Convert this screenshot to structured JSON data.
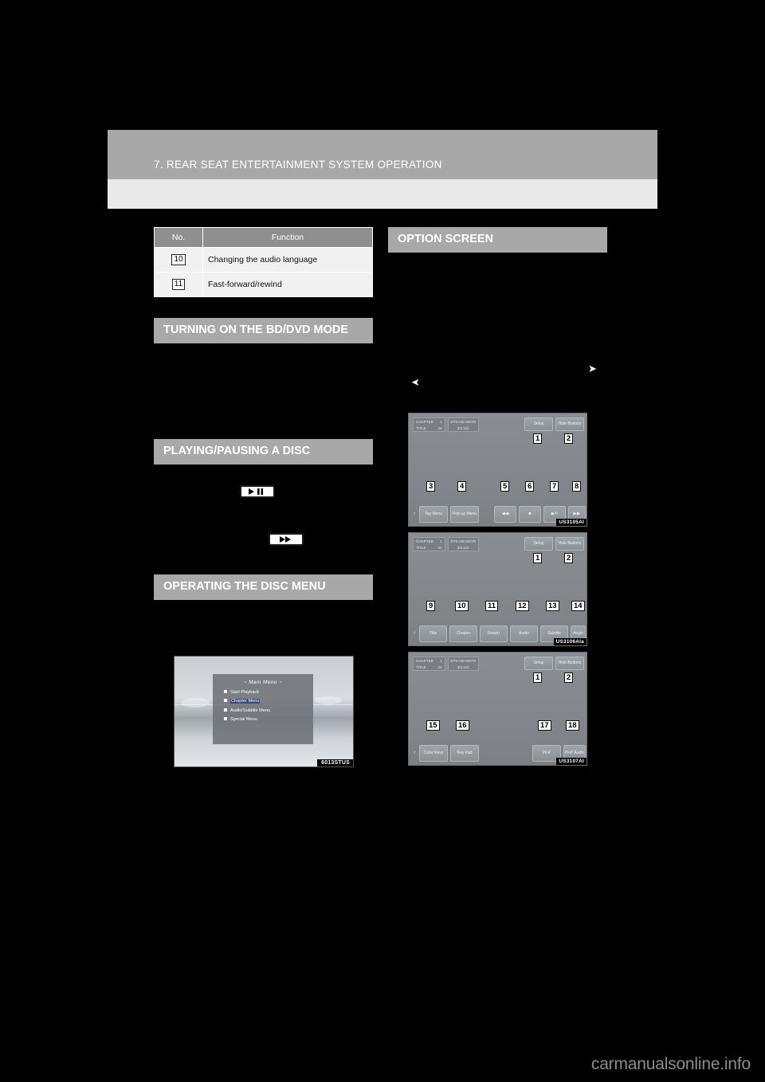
{
  "header": {
    "chapter_title": "7. REAR SEAT ENTERTAINMENT SYSTEM OPERATION"
  },
  "left_column": {
    "table": {
      "columns": [
        "No.",
        "Function"
      ],
      "rows": [
        {
          "no": "10",
          "function": "Changing the audio language"
        },
        {
          "no": "11",
          "function": "Fast-forward/rewind"
        }
      ]
    },
    "sections": [
      {
        "title": "TURNING ON THE BD/DVD MODE"
      },
      {
        "title": "PLAYING/PAUSING A DISC"
      },
      {
        "title": "OPERATING THE DISC MENU"
      }
    ],
    "inline_buttons": {
      "play_pause": "play-pause",
      "fast_forward": "fast-forward"
    },
    "figure": {
      "code": "6013STUS",
      "menu_title": "~  Main Menu  ~",
      "items": [
        {
          "label": "Start Playback",
          "selected": false
        },
        {
          "label": "Chapter Menu",
          "selected": true
        },
        {
          "label": "Audio/Subtitle Menu",
          "selected": false
        },
        {
          "label": "Special Menu",
          "selected": false
        }
      ]
    }
  },
  "right_column": {
    "section_title": "OPTION SCREEN",
    "ref_arrow_left": "➤",
    "ref_arrow_right": "➤",
    "screens": [
      {
        "code": "US3105AI",
        "info": {
          "chapter_label": "CHAPTER",
          "chapter_value": "1",
          "title_label": "TITLE",
          "title_value": "24",
          "audio_format": "DTS-HD MSTR",
          "audio_channels": "3/2.1ch"
        },
        "top_buttons": [
          {
            "label": "Setup",
            "callout": "1"
          },
          {
            "label": "Hide Buttons",
            "callout": "2"
          }
        ],
        "bottom_buttons": [
          {
            "label": "Top Menu",
            "callout": "3"
          },
          {
            "label": "Pop-up Menu",
            "callout": "4"
          },
          {
            "label": "◀◀",
            "callout": "5"
          },
          {
            "label": "■",
            "callout": "6"
          },
          {
            "label": "▶II",
            "callout": "7"
          },
          {
            "label": "▶▶",
            "callout": "8"
          }
        ],
        "pager_prev": "‹",
        "pager_next": "›"
      },
      {
        "code": "US3106AIa",
        "info": {
          "chapter_label": "CHAPTER",
          "chapter_value": "1",
          "title_label": "TITLE",
          "title_value": "24",
          "audio_format": "DTS-HD MSTR",
          "audio_channels": "3/2.1ch"
        },
        "top_buttons": [
          {
            "label": "Setup",
            "callout": "1"
          },
          {
            "label": "Hide Buttons",
            "callout": "2"
          }
        ],
        "bottom_buttons": [
          {
            "label": "Title",
            "callout": "9"
          },
          {
            "label": "Chapter",
            "callout": "10"
          },
          {
            "label": "Return",
            "callout": "11"
          },
          {
            "label": "Audio",
            "callout": "12"
          },
          {
            "label": "Subtitle",
            "callout": "13"
          },
          {
            "label": "Angle",
            "callout": "14"
          }
        ],
        "pager_prev": "‹",
        "pager_next": "›"
      },
      {
        "code": "US3107AI",
        "info": {
          "chapter_label": "CHAPTER",
          "chapter_value": "1",
          "title_label": "TITLE",
          "title_value": "24",
          "audio_format": "DTS-HD MSTR",
          "audio_channels": "3/2.1ch"
        },
        "top_buttons": [
          {
            "label": "Setup",
            "callout": "1"
          },
          {
            "label": "Hide Buttons",
            "callout": "2"
          }
        ],
        "bottom_buttons": [
          {
            "label": "Color Keys",
            "callout": "15"
          },
          {
            "label": "Key Pad",
            "callout": "16"
          },
          {
            "label": "PinP",
            "callout": "17"
          },
          {
            "label": "PinP Audio",
            "callout": "18"
          }
        ],
        "pager_prev": "‹",
        "pager_next": "›"
      }
    ]
  },
  "watermark": "carmanualsonline.info"
}
